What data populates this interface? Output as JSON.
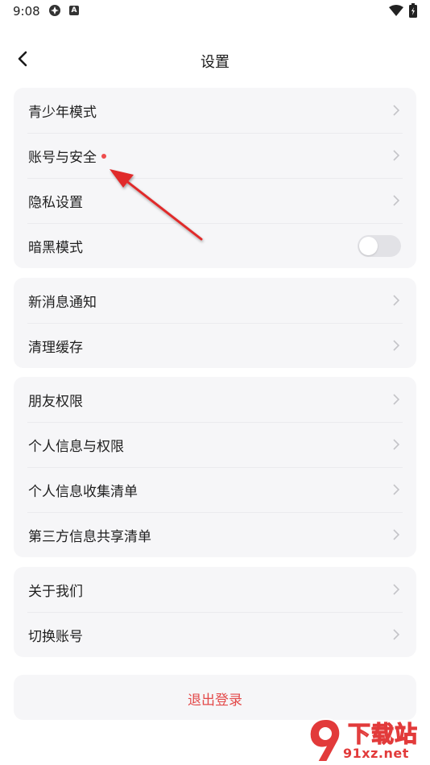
{
  "status_bar": {
    "time": "9:08",
    "notif_icon_letter": "A"
  },
  "header": {
    "title": "设置"
  },
  "groups": [
    {
      "items": [
        {
          "label": "青少年模式"
        },
        {
          "label": "账号与安全"
        },
        {
          "label": "隐私设置"
        },
        {
          "label": "暗黑模式",
          "toggle_on": false
        }
      ]
    },
    {
      "items": [
        {
          "label": "新消息通知"
        },
        {
          "label": "清理缓存"
        }
      ]
    },
    {
      "items": [
        {
          "label": "朋友权限"
        },
        {
          "label": "个人信息与权限"
        },
        {
          "label": "个人信息收集清单"
        },
        {
          "label": "第三方信息共享清单"
        }
      ]
    },
    {
      "items": [
        {
          "label": "关于我们"
        },
        {
          "label": "切换账号"
        }
      ]
    }
  ],
  "logout": {
    "label": "退出登录"
  },
  "watermark": {
    "top": "下载站",
    "bottom": "91xz.net"
  },
  "colors": {
    "accent_red": "#e34a4a",
    "card_bg": "#f6f6f8",
    "toggle_off": "#e2e2e6"
  }
}
